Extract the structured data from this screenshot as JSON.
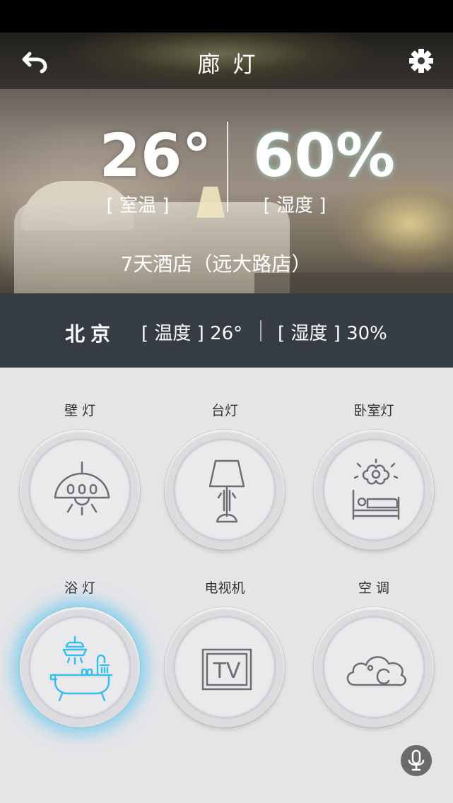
{
  "header": {
    "title": "廊灯",
    "back_icon": "back-arrow-icon",
    "settings_icon": "gear-icon"
  },
  "room": {
    "temperature": "26°",
    "temperature_label": "[ 室温 ]",
    "humidity": "60%",
    "humidity_label": "[ 湿度 ]",
    "hotel_name": "7天酒店（远大路店）"
  },
  "city_weather": {
    "city": "北京",
    "temperature": "[ 温度 ] 26°",
    "humidity": "[ 湿度 ] 30%"
  },
  "devices": [
    {
      "label": "壁 灯",
      "icon": "wall-lamp-icon",
      "active": false
    },
    {
      "label": "台灯",
      "icon": "table-lamp-icon",
      "active": false
    },
    {
      "label": "卧室灯",
      "icon": "bedroom-light-icon",
      "active": false
    },
    {
      "label": "浴 灯",
      "icon": "bath-light-icon",
      "active": true
    },
    {
      "label": "电视机",
      "icon": "tv-icon",
      "active": false
    },
    {
      "label": "空 调",
      "icon": "air-conditioner-icon",
      "active": false
    }
  ],
  "mic_icon": "microphone-icon",
  "colors": {
    "active_accent": "#3abef0",
    "icon_default": "#6e6e72",
    "band": "#363c44"
  }
}
